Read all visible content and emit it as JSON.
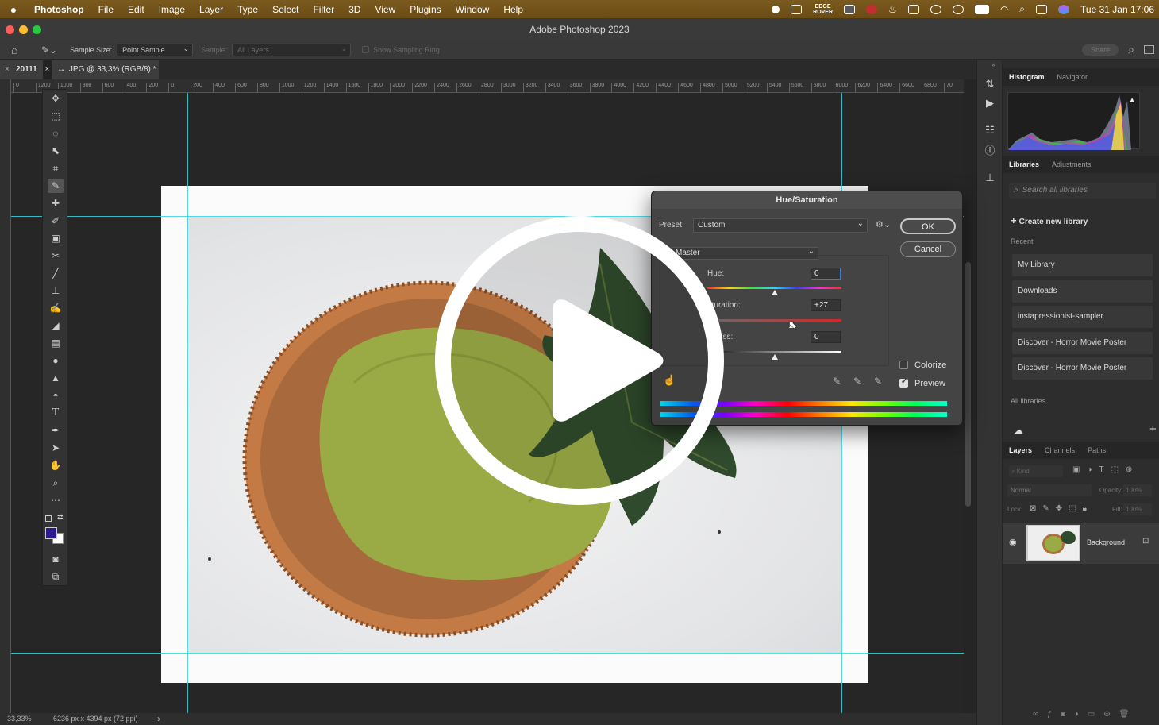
{
  "menubar": {
    "items": [
      "Photoshop",
      "File",
      "Edit",
      "Image",
      "Layer",
      "Type",
      "Select",
      "Filter",
      "3D",
      "View",
      "Plugins",
      "Window",
      "Help"
    ],
    "edgerover_line1": "EDGE",
    "edgerover_line2": "ROVER",
    "clock": "Tue 31 Jan  17:06"
  },
  "window": {
    "title": "Adobe Photoshop 2023"
  },
  "options": {
    "sample_size_label": "Sample Size:",
    "sample_size_value": "Point Sample",
    "sample_label": "Sample:",
    "sample_value": "All Layers",
    "sampling_ring_label": "Show Sampling Ring",
    "share_label": "Share"
  },
  "document": {
    "tab_prefix": "20111",
    "tab_suffix": "JPG @ 33,3% (RGB/8) *"
  },
  "ruler": {
    "ticks": [
      "0",
      "1200",
      "1000",
      "800",
      "600",
      "400",
      "200",
      "0",
      "200",
      "400",
      "600",
      "800",
      "1000",
      "1200",
      "1400",
      "1600",
      "1800",
      "2000",
      "2200",
      "2400",
      "2600",
      "2800",
      "3000",
      "3200",
      "3400",
      "3600",
      "3800",
      "4000",
      "4200",
      "4400",
      "4600",
      "4800",
      "5000",
      "5200",
      "5400",
      "5600",
      "5800",
      "6000",
      "6200",
      "6400",
      "6600",
      "6800",
      "70"
    ]
  },
  "status": {
    "zoom": "33,33%",
    "dimensions": "6236 px x 4394 px (72 ppi)",
    "arrow": "›"
  },
  "dialog": {
    "title": "Hue/Saturation",
    "preset_label": "Preset:",
    "preset_value": "Custom",
    "ok_label": "OK",
    "cancel_label": "Cancel",
    "channel_value": "Master",
    "hue_label": "Hue:",
    "hue_value": "0",
    "saturation_label": "aturation:",
    "saturation_value": "+27",
    "lightness_label": "ntness:",
    "lightness_value": "0",
    "colorize_label": "Colorize",
    "colorize_checked": false,
    "preview_label": "Preview",
    "preview_checked": true,
    "hue_level": 0,
    "saturation_level": 27,
    "lightness_level": 0
  },
  "panels": {
    "top_tabs": [
      "Histogram",
      "Navigator"
    ],
    "lib_tabs": [
      "Libraries",
      "Adjustments"
    ],
    "search_placeholder": "Search all libraries",
    "create_library": "Create new library",
    "recent_label": "Recent",
    "recent_items": [
      "My Library",
      "Downloads",
      "instapressionist-sampler",
      "Discover - Horror Movie Poster",
      "Discover - Horror Movie Poster"
    ],
    "all_libraries": "All libraries",
    "layer_tabs": [
      "Layers",
      "Channels",
      "Paths"
    ],
    "kind_placeholder": "Kind",
    "blend_mode": "Normal",
    "opacity_label": "Opacity:",
    "opacity_value": "100%",
    "lock_label": "Lock:",
    "fill_label": "Fill:",
    "fill_value": "100%",
    "layer_name": "Background"
  },
  "colors": {
    "guide": "#3bd4e0",
    "foreground_swatch": "#2a1a8a",
    "menubar": "#7a5a1e"
  }
}
